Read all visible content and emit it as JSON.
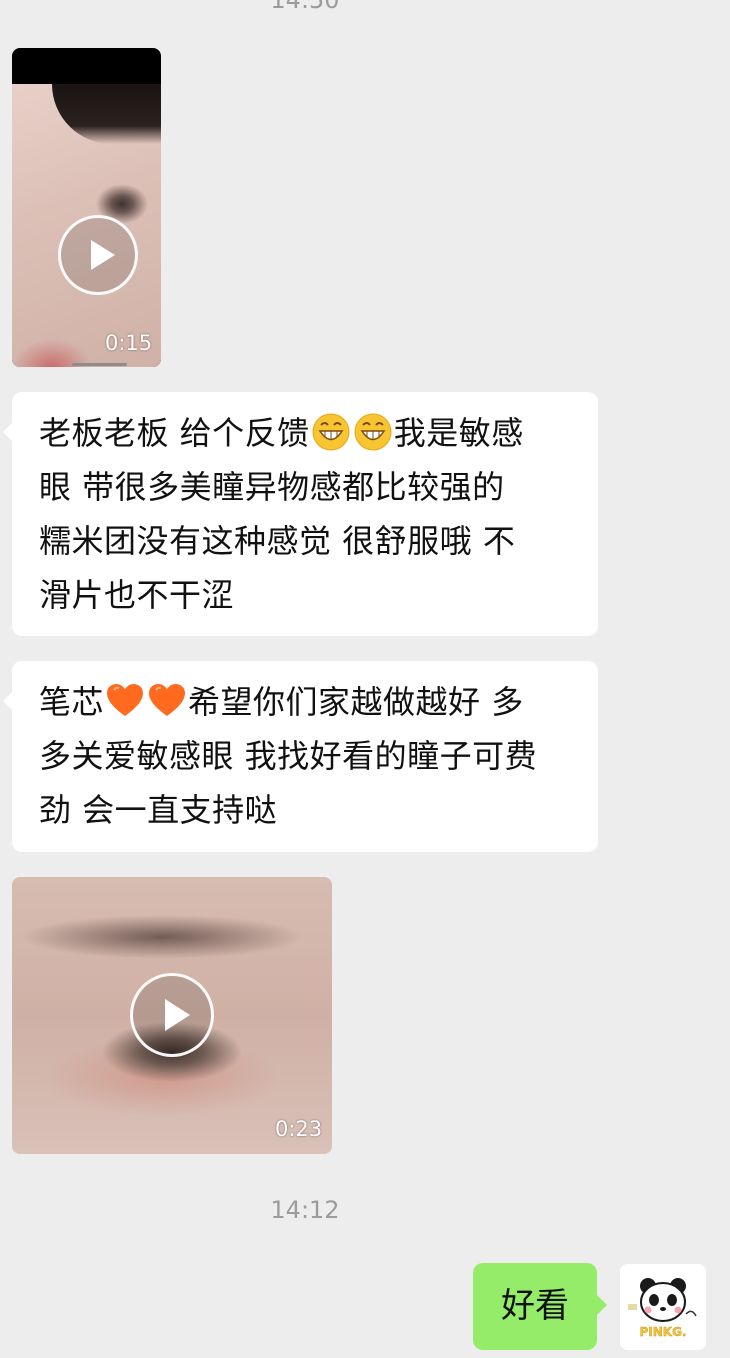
{
  "timestamps": {
    "top": "14:50",
    "middle": "14:12"
  },
  "messages": [
    {
      "type": "video",
      "direction": "incoming",
      "duration": "0:15",
      "icon": "play-icon"
    },
    {
      "type": "text",
      "direction": "incoming",
      "lines": [
        [
          "老板老板 给个反馈",
          "grin-emoji",
          "grin-emoji",
          "我是敏感"
        ],
        [
          "眼 带很多美瞳异物感都比较强的"
        ],
        [
          "糯米团没有这种感觉 很舒服哦 不"
        ],
        [
          "滑片也不干涩"
        ]
      ]
    },
    {
      "type": "text",
      "direction": "incoming",
      "lines": [
        [
          "笔芯",
          "orange-heart-emoji",
          "orange-heart-emoji",
          "希望你们家越做越好 多"
        ],
        [
          "多关爱敏感眼 我找好看的瞳子可费"
        ],
        [
          "劲 会一直支持哒"
        ]
      ]
    },
    {
      "type": "video",
      "direction": "incoming",
      "duration": "0:23",
      "icon": "play-icon"
    },
    {
      "type": "text",
      "direction": "outgoing",
      "text": "好看"
    }
  ],
  "avatar": {
    "label": "PINKG.",
    "icon": "panda-avatar-icon"
  },
  "colors": {
    "background": "#ededed",
    "incoming_bubble": "#ffffff",
    "outgoing_bubble": "#95ec69",
    "timestamp": "#9b9b9b"
  }
}
